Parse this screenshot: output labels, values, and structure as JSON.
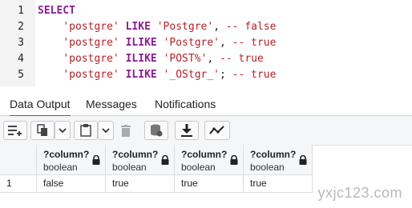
{
  "editor": {
    "lines": [
      {
        "no": "1",
        "parts": [
          {
            "t": "SELECT",
            "c": "kw"
          }
        ]
      },
      {
        "no": "2",
        "parts": [
          {
            "t": "    ",
            "c": ""
          },
          {
            "t": "'postgre'",
            "c": "str"
          },
          {
            "t": " ",
            "c": ""
          },
          {
            "t": "LIKE",
            "c": "kw"
          },
          {
            "t": " ",
            "c": ""
          },
          {
            "t": "'Postgre'",
            "c": "str"
          },
          {
            "t": ", ",
            "c": ""
          },
          {
            "t": "-- false",
            "c": "cm"
          }
        ]
      },
      {
        "no": "3",
        "parts": [
          {
            "t": "    ",
            "c": ""
          },
          {
            "t": "'postgre'",
            "c": "str"
          },
          {
            "t": " ",
            "c": ""
          },
          {
            "t": "ILIKE",
            "c": "kw"
          },
          {
            "t": " ",
            "c": ""
          },
          {
            "t": "'Postgre'",
            "c": "str"
          },
          {
            "t": ", ",
            "c": ""
          },
          {
            "t": "-- true",
            "c": "cm"
          }
        ]
      },
      {
        "no": "4",
        "parts": [
          {
            "t": "    ",
            "c": ""
          },
          {
            "t": "'postgre'",
            "c": "str"
          },
          {
            "t": " ",
            "c": ""
          },
          {
            "t": "ILIKE",
            "c": "kw"
          },
          {
            "t": " ",
            "c": ""
          },
          {
            "t": "'POST%'",
            "c": "str"
          },
          {
            "t": ", ",
            "c": ""
          },
          {
            "t": "-- true",
            "c": "cm"
          }
        ]
      },
      {
        "no": "5",
        "parts": [
          {
            "t": "    ",
            "c": ""
          },
          {
            "t": "'postgre'",
            "c": "str"
          },
          {
            "t": " ",
            "c": ""
          },
          {
            "t": "ILIKE",
            "c": "kw"
          },
          {
            "t": " ",
            "c": ""
          },
          {
            "t": "'_OStgr_'",
            "c": "str"
          },
          {
            "t": "; ",
            "c": ""
          },
          {
            "t": "-- true",
            "c": "cm"
          }
        ]
      }
    ]
  },
  "tabs": [
    {
      "label": "Data Output",
      "active": true
    },
    {
      "label": "Messages",
      "active": false
    },
    {
      "label": "Notifications",
      "active": false
    }
  ],
  "toolbar": {
    "buttons": [
      "add-row-icon",
      "copy-icon",
      "chevron-down-icon",
      "paste-icon",
      "chevron-down-icon",
      "delete-icon",
      "save-data-icon",
      "download-icon",
      "graph-visualiser-icon"
    ]
  },
  "grid": {
    "columns": [
      {
        "name": "?column?",
        "type": "boolean"
      },
      {
        "name": "?column?",
        "type": "boolean"
      },
      {
        "name": "?column?",
        "type": "boolean"
      },
      {
        "name": "?column?",
        "type": "boolean"
      }
    ],
    "rows": [
      {
        "num": "1",
        "cells": [
          "false",
          "true",
          "true",
          "true"
        ]
      }
    ]
  },
  "watermark": "yxjc123.com",
  "colors": {
    "keyword": "#8a1c8f",
    "string": "#b5202a",
    "accent": "#326fa8"
  }
}
